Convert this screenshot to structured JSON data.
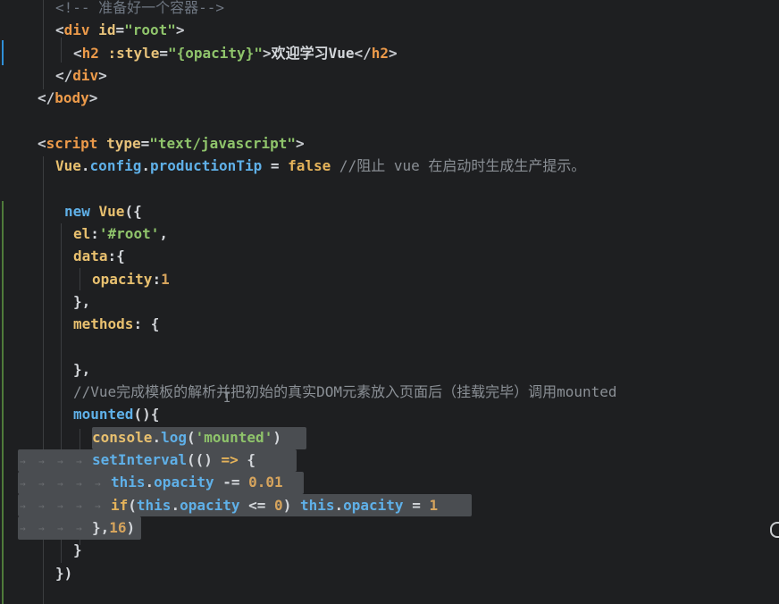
{
  "lines": [
    [
      {
        "t": "<!-- 准备好一个容器-->",
        "c": "c-cm"
      }
    ],
    [
      {
        "t": "<",
        "c": "c-tag"
      },
      {
        "t": "div",
        "c": "c-tagname"
      },
      {
        "t": " id",
        "c": "c-attr"
      },
      {
        "t": "=",
        "c": "c-plain"
      },
      {
        "t": "\"root\"",
        "c": "c-str"
      },
      {
        "t": ">",
        "c": "c-tag"
      }
    ],
    [
      {
        "t": "<",
        "c": "c-tag"
      },
      {
        "t": "h2",
        "c": "c-tagname"
      },
      {
        "t": " :style",
        "c": "c-attr"
      },
      {
        "t": "=",
        "c": "c-plain"
      },
      {
        "t": "\"{opacity}\"",
        "c": "c-str"
      },
      {
        "t": ">",
        "c": "c-tag"
      },
      {
        "t": "欢迎学习Vue",
        "c": "c-plain"
      },
      {
        "t": "</",
        "c": "c-tag"
      },
      {
        "t": "h2",
        "c": "c-tagname"
      },
      {
        "t": ">",
        "c": "c-tag"
      }
    ],
    [
      {
        "t": "</",
        "c": "c-tag"
      },
      {
        "t": "div",
        "c": "c-tagname"
      },
      {
        "t": ">",
        "c": "c-tag"
      }
    ],
    [
      {
        "t": "</",
        "c": "c-tag"
      },
      {
        "t": "body",
        "c": "c-tagname"
      },
      {
        "t": ">",
        "c": "c-tag"
      }
    ],
    [],
    [
      {
        "t": "<",
        "c": "c-tag"
      },
      {
        "t": "script",
        "c": "c-tagname"
      },
      {
        "t": " type",
        "c": "c-attr"
      },
      {
        "t": "=",
        "c": "c-plain"
      },
      {
        "t": "\"text/javascript\"",
        "c": "c-str"
      },
      {
        "t": ">",
        "c": "c-tag"
      }
    ],
    [
      {
        "t": "Vue",
        "c": "c-obj"
      },
      {
        "t": ".",
        "c": "c-plain"
      },
      {
        "t": "config",
        "c": "c-var"
      },
      {
        "t": ".",
        "c": "c-plain"
      },
      {
        "t": "productionTip",
        "c": "c-var"
      },
      {
        "t": " = ",
        "c": "c-op"
      },
      {
        "t": "false",
        "c": "c-kw"
      },
      {
        "t": " //阻止 vue 在启动时生成生产提示。",
        "c": "c-cmt"
      }
    ],
    [],
    [
      {
        "t": "new ",
        "c": "c-var"
      },
      {
        "t": "Vue",
        "c": "c-obj"
      },
      {
        "t": "({",
        "c": "c-plain"
      }
    ],
    [
      {
        "t": "el",
        "c": "c-obj"
      },
      {
        "t": ":",
        "c": "c-plain"
      },
      {
        "t": "'#root'",
        "c": "c-str"
      },
      {
        "t": ",",
        "c": "c-plain"
      }
    ],
    [
      {
        "t": "data",
        "c": "c-obj"
      },
      {
        "t": ":{",
        "c": "c-plain"
      }
    ],
    [
      {
        "t": "opacity",
        "c": "c-obj"
      },
      {
        "t": ":",
        "c": "c-plain"
      },
      {
        "t": "1",
        "c": "c-num"
      }
    ],
    [
      {
        "t": "},",
        "c": "c-plain"
      }
    ],
    [
      {
        "t": "methods",
        "c": "c-obj"
      },
      {
        "t": ": {",
        "c": "c-plain"
      }
    ],
    [],
    [
      {
        "t": "},",
        "c": "c-plain"
      }
    ],
    [
      {
        "t": "//Vue完成模板的解析并把初始的真实DOM元素放入页面后（挂载完毕）调用mounted",
        "c": "c-cmt"
      }
    ],
    [
      {
        "t": "mounted",
        "c": "c-fn"
      },
      {
        "t": "(){",
        "c": "c-plain"
      }
    ],
    [
      {
        "t": "console",
        "c": "c-obj"
      },
      {
        "t": ".",
        "c": "c-plain"
      },
      {
        "t": "log",
        "c": "c-fn"
      },
      {
        "t": "(",
        "c": "c-plain"
      },
      {
        "t": "'mounted'",
        "c": "c-str"
      },
      {
        "t": ")",
        "c": "c-plain"
      }
    ],
    [
      {
        "t": "setInterval",
        "c": "c-fn"
      },
      {
        "t": "(() ",
        "c": "c-plain"
      },
      {
        "t": "=>",
        "c": "c-kw"
      },
      {
        "t": " {",
        "c": "c-plain"
      }
    ],
    [
      {
        "t": "this",
        "c": "c-var"
      },
      {
        "t": ".",
        "c": "c-plain"
      },
      {
        "t": "opacity",
        "c": "c-var"
      },
      {
        "t": " -= ",
        "c": "c-op"
      },
      {
        "t": "0.01",
        "c": "c-num"
      }
    ],
    [
      {
        "t": "if",
        "c": "c-kw"
      },
      {
        "t": "(",
        "c": "c-plain"
      },
      {
        "t": "this",
        "c": "c-var"
      },
      {
        "t": ".",
        "c": "c-plain"
      },
      {
        "t": "opacity",
        "c": "c-var"
      },
      {
        "t": " <= ",
        "c": "c-op"
      },
      {
        "t": "0",
        "c": "c-num"
      },
      {
        "t": ") ",
        "c": "c-plain"
      },
      {
        "t": "this",
        "c": "c-var"
      },
      {
        "t": ".",
        "c": "c-plain"
      },
      {
        "t": "opacity",
        "c": "c-var"
      },
      {
        "t": " = ",
        "c": "c-op"
      },
      {
        "t": "1",
        "c": "c-num"
      }
    ],
    [
      {
        "t": "},",
        "c": "c-plain"
      },
      {
        "t": "16",
        "c": "c-num"
      },
      {
        "t": ")",
        "c": "c-plain"
      }
    ],
    [
      {
        "t": "}",
        "c": "c-plain"
      }
    ],
    [
      {
        "t": "})",
        "c": "c-plain"
      }
    ]
  ],
  "colors": {
    "background": "#1e1f21",
    "selection": "#4a4d51",
    "gutter_modified": "#2f8fd8",
    "gutter_added": "#4f7a3a"
  }
}
